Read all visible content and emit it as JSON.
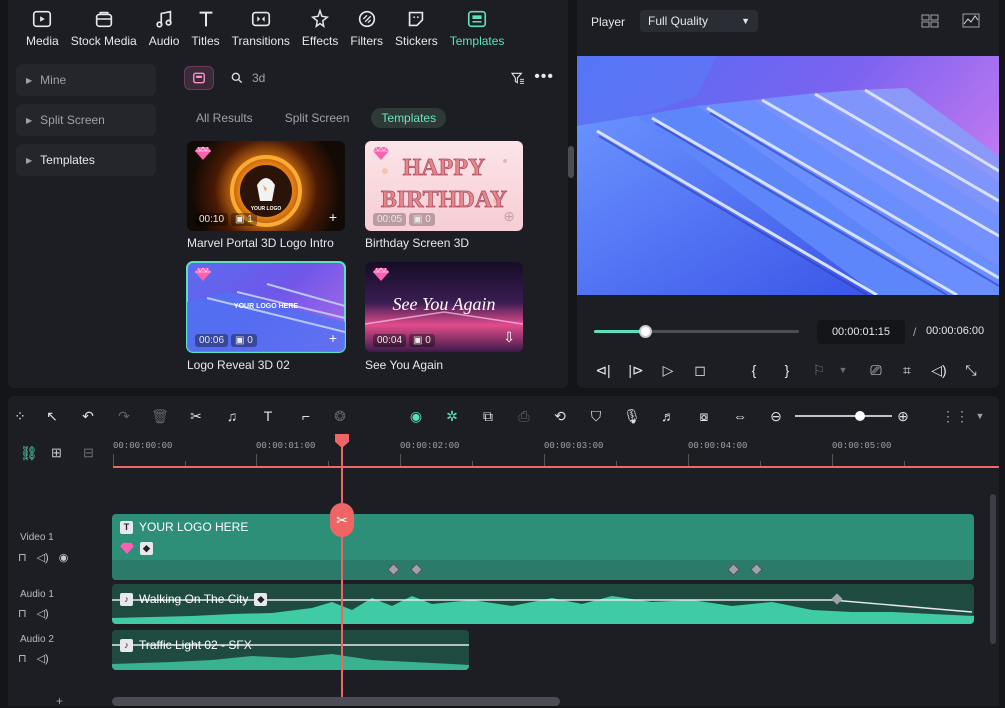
{
  "toolbar": {
    "tabs": [
      {
        "label": "Media",
        "icon": "media-icon"
      },
      {
        "label": "Stock Media",
        "icon": "stock-media-icon"
      },
      {
        "label": "Audio",
        "icon": "audio-icon"
      },
      {
        "label": "Titles",
        "icon": "titles-icon"
      },
      {
        "label": "Transitions",
        "icon": "transitions-icon"
      },
      {
        "label": "Effects",
        "icon": "effects-icon"
      },
      {
        "label": "Filters",
        "icon": "filters-icon"
      },
      {
        "label": "Stickers",
        "icon": "stickers-icon"
      },
      {
        "label": "Templates",
        "icon": "templates-icon",
        "active": true
      }
    ]
  },
  "sidebar": {
    "items": [
      {
        "label": "Mine"
      },
      {
        "label": "Split Screen"
      },
      {
        "label": "Templates",
        "active": true
      }
    ]
  },
  "search": {
    "query": "3d"
  },
  "filters": {
    "chips": [
      "All Results",
      "Split Screen",
      "Templates"
    ],
    "active": "Templates"
  },
  "templates": [
    {
      "name": "Marvel Portal 3D Logo Intro",
      "duration": "00:10",
      "count": "1",
      "thumb_text": "YOUR LOGO"
    },
    {
      "name": "Birthday Screen 3D",
      "duration": "00:05",
      "count": "0",
      "thumb_text_1": "HAPPY",
      "thumb_text_2": "BIRTHDAY"
    },
    {
      "name": "Logo Reveal 3D 02",
      "duration": "00:06",
      "count": "0",
      "thumb_text": "YOUR LOGO HERE",
      "selected": true
    },
    {
      "name": "See You Again",
      "duration": "00:04",
      "count": "0",
      "thumb_text": "See You Again"
    }
  ],
  "player": {
    "title": "Player",
    "quality": "Full Quality",
    "current_time": "00:00:01:15",
    "separator": "/",
    "total_time": "00:00:06:00",
    "progress": 0.25
  },
  "timeline": {
    "ruler": [
      "00:00:00:00",
      "00:00:01:00",
      "00:00:02:00",
      "00:00:03:00",
      "00:00:04:00",
      "00:00:05:00"
    ],
    "tracks": [
      {
        "label": "Video 1"
      },
      {
        "label": "Audio 1"
      },
      {
        "label": "Audio 2"
      }
    ],
    "clips": {
      "video": "YOUR LOGO HERE",
      "audio1": "Walking On The City",
      "audio2": "Traffic Light 02 - SFX"
    }
  },
  "colors": {
    "accent": "#5ce1c0",
    "playhead": "#ef6565",
    "clip": "#2e8f78"
  }
}
